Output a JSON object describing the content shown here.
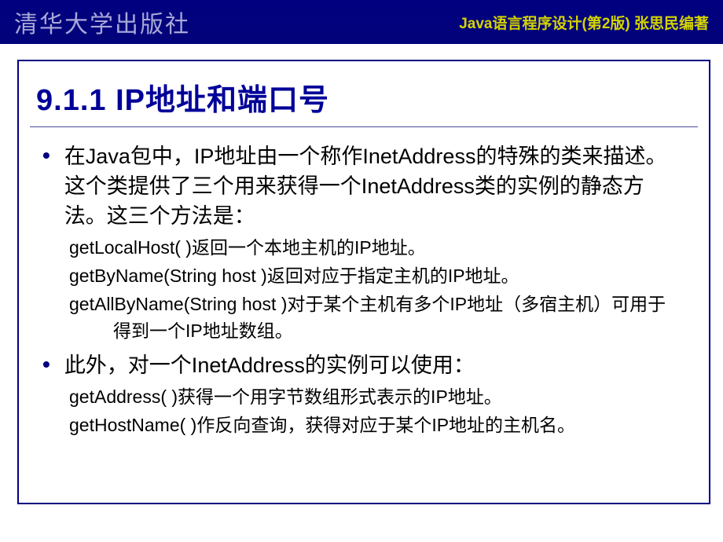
{
  "header": {
    "publisher": "清华大学出版社",
    "book_info": "Java语言程序设计(第2版)  张思民编著"
  },
  "slide": {
    "title": "9.1.1    IP地址和端口号",
    "bullets": [
      {
        "text": "在Java包中，IP地址由一个称作InetAddress的特殊的类来描述。这个类提供了三个用来获得一个InetAddress类的实例的静态方法。这三个方法是：",
        "subs": [
          "getLocalHost( )返回一个本地主机的IP地址。",
          "getByName(String host )返回对应于指定主机的IP地址。",
          "getAllByName(String host )对于某个主机有多个IP地址（多宿主机）可用于得到一个IP地址数组。"
        ]
      },
      {
        "text": "此外，对一个InetAddress的实例可以使用：",
        "subs": [
          "getAddress( )获得一个用字节数组形式表示的IP地址。",
          "getHostName( )作反向查询，获得对应于某个IP地址的主机名。"
        ]
      }
    ]
  }
}
